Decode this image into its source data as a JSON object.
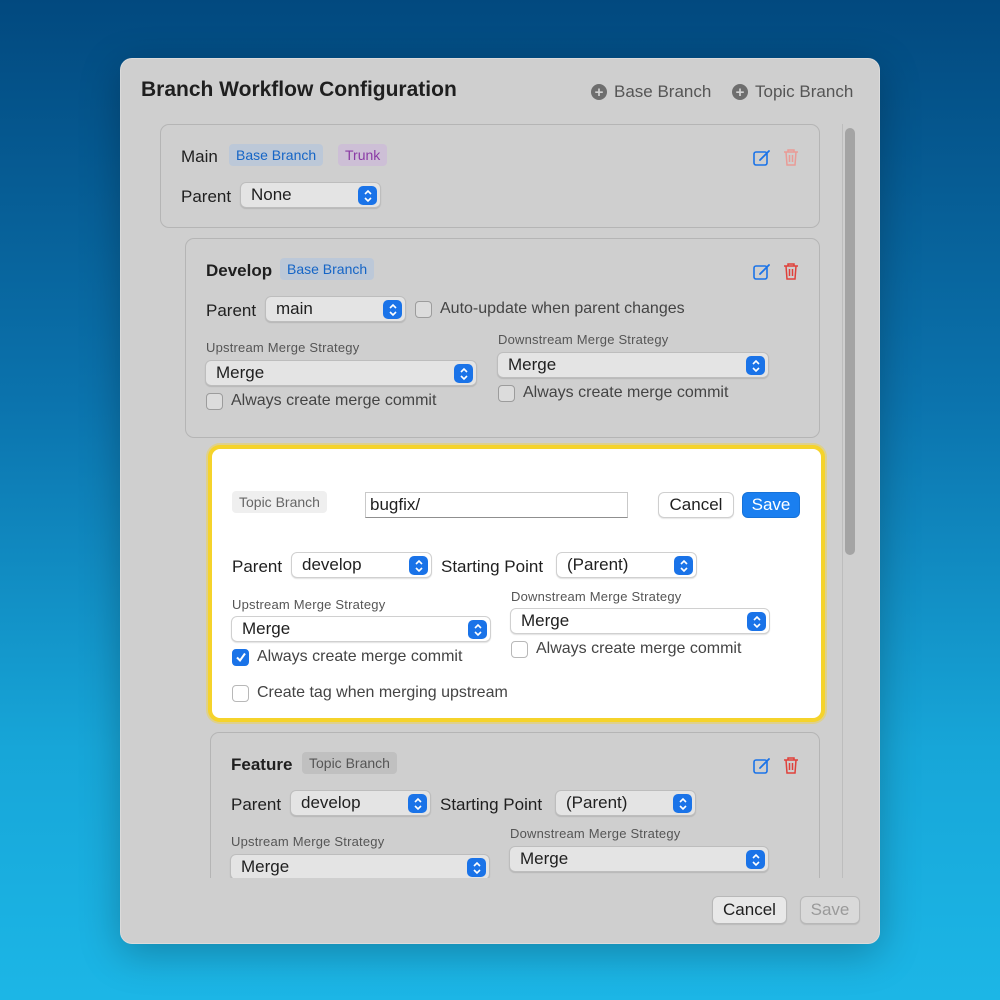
{
  "dialog": {
    "title": "Branch Workflow Configuration",
    "add_base_label": "Base Branch",
    "add_topic_label": "Topic Branch"
  },
  "main_card": {
    "name": "Main",
    "badges": [
      "Base Branch",
      "Trunk"
    ],
    "parent_label": "Parent",
    "parent_value": "None"
  },
  "develop_card": {
    "name": "Develop",
    "badge": "Base Branch",
    "parent_label": "Parent",
    "parent_value": "main",
    "auto_update_label": "Auto-update when parent changes",
    "auto_update_checked": false,
    "upstream_label": "Upstream Merge Strategy",
    "upstream_value": "Merge",
    "upstream_merge_commit_label": "Always create merge commit",
    "upstream_merge_commit_checked": false,
    "downstream_label": "Downstream Merge Strategy",
    "downstream_value": "Merge",
    "downstream_merge_commit_label": "Always create merge commit",
    "downstream_merge_commit_checked": false
  },
  "editor": {
    "badge": "Topic Branch",
    "name_value": "bugfix/",
    "cancel_label": "Cancel",
    "save_label": "Save",
    "parent_label": "Parent",
    "parent_value": "develop",
    "starting_point_label": "Starting Point",
    "starting_point_value": "(Parent)",
    "upstream_label": "Upstream Merge Strategy",
    "upstream_value": "Merge",
    "upstream_merge_commit_label": "Always create merge commit",
    "upstream_merge_commit_checked": true,
    "downstream_label": "Downstream Merge Strategy",
    "downstream_value": "Merge",
    "downstream_merge_commit_label": "Always create merge commit",
    "downstream_merge_commit_checked": false,
    "create_tag_label": "Create tag when merging upstream",
    "create_tag_checked": false
  },
  "feature_card": {
    "name": "Feature",
    "badge": "Topic Branch",
    "parent_label": "Parent",
    "parent_value": "develop",
    "starting_point_label": "Starting Point",
    "starting_point_value": "(Parent)",
    "upstream_label": "Upstream Merge Strategy",
    "upstream_value": "Merge",
    "downstream_label": "Downstream Merge Strategy",
    "downstream_value": "Merge"
  },
  "footer": {
    "cancel_label": "Cancel",
    "save_label": "Save"
  },
  "colors": {
    "accent": "#1a73e8",
    "highlight": "#f5d32b",
    "delete": "#e0403a"
  },
  "icons": [
    "plus-icon",
    "edit-icon",
    "trash-icon",
    "chevron-up-down-icon",
    "checkmark-icon"
  ]
}
